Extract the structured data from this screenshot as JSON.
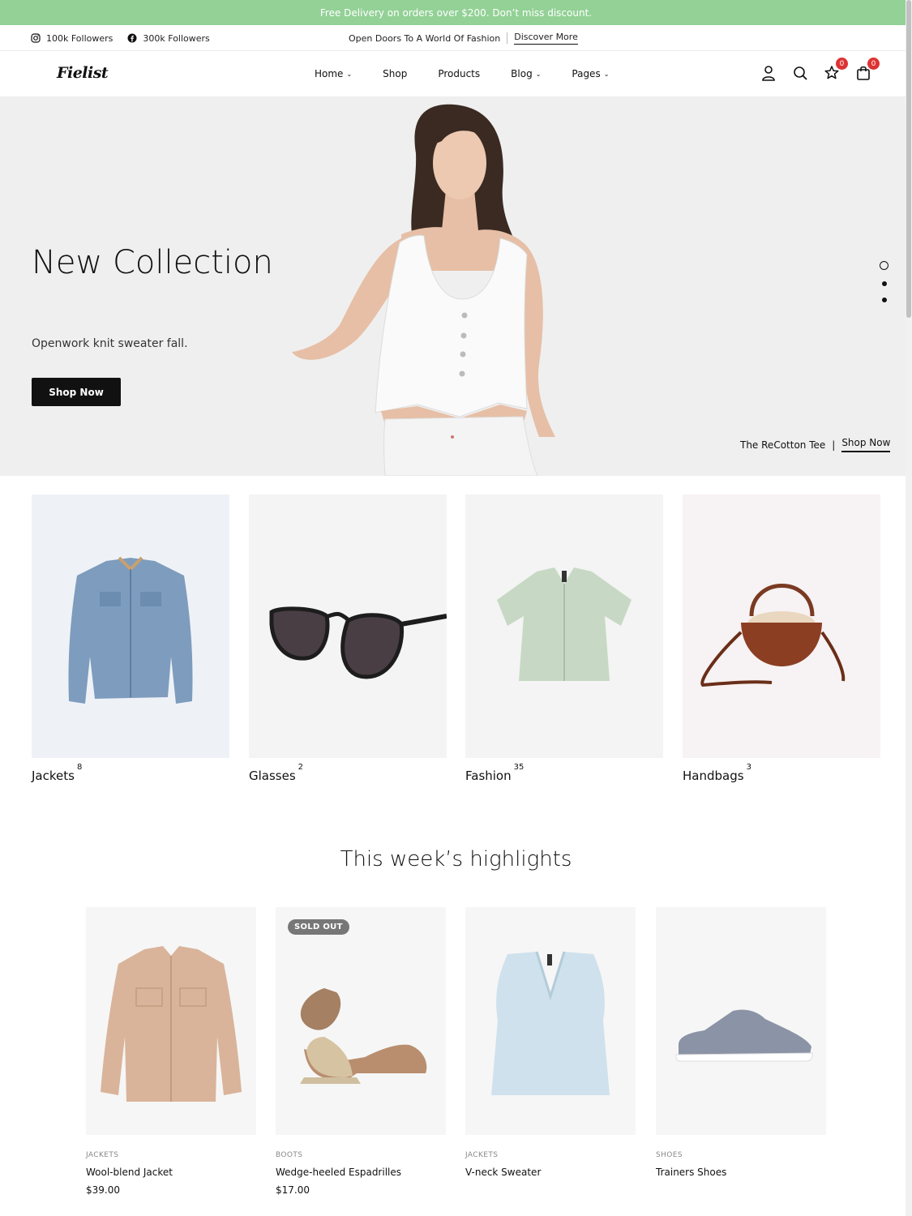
{
  "announcement": "Free Delivery on orders over $200. Don’t miss discount.",
  "social": [
    {
      "icon": "instagram-icon",
      "label": "100k Followers"
    },
    {
      "icon": "facebook-icon",
      "label": "300k Followers"
    }
  ],
  "promo": {
    "text": "Open Doors To A World Of Fashion",
    "link": "Discover More"
  },
  "header": {
    "logo": "Fielist",
    "nav": [
      {
        "label": "Home",
        "caret": true
      },
      {
        "label": "Shop",
        "caret": false
      },
      {
        "label": "Products",
        "caret": false
      },
      {
        "label": "Blog",
        "caret": true
      },
      {
        "label": "Pages",
        "caret": true
      }
    ],
    "wishlist_count": "0",
    "cart_count": "0"
  },
  "hero": {
    "title": "New Collection",
    "subtitle": "Openwork knit sweater fall.",
    "button": "Shop Now",
    "caption": "The ReCotton Tee",
    "caption_sep": "|",
    "caption_link": "Shop Now"
  },
  "categories": [
    {
      "name": "Jackets",
      "count": "8"
    },
    {
      "name": "Glasses",
      "count": "2"
    },
    {
      "name": "Fashion",
      "count": "35"
    },
    {
      "name": "Handbags",
      "count": "3"
    }
  ],
  "highlights": {
    "title": "This week’s highlights",
    "products": [
      {
        "category": "JACKETS",
        "name": "Wool-blend Jacket",
        "price": "$39.00",
        "badge": ""
      },
      {
        "category": "BOOTS",
        "name": "Wedge-heeled Espadrilles",
        "price": "$17.00",
        "badge": "SOLD OUT"
      },
      {
        "category": "JACKETS",
        "name": "V-neck Sweater",
        "price": "",
        "badge": ""
      },
      {
        "category": "SHOES",
        "name": "Trainers Shoes",
        "price": "",
        "badge": ""
      }
    ]
  },
  "colors": {
    "announcement_bg": "#93d196",
    "badge": "#dd3333",
    "button_bg": "#111111"
  }
}
